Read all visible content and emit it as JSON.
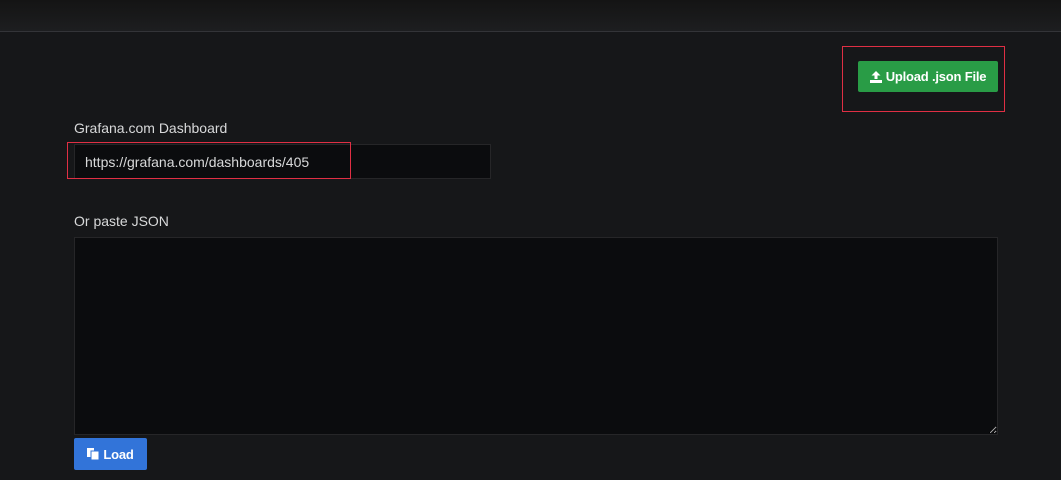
{
  "buttons": {
    "upload_label": "Upload .json File",
    "load_label": "Load"
  },
  "grafana_com": {
    "label": "Grafana.com Dashboard",
    "url_value": "https://grafana.com/dashboards/405"
  },
  "paste_json": {
    "label": "Or paste JSON",
    "value": ""
  },
  "icons": {
    "upload": "upload-icon",
    "load": "copy-icon"
  },
  "colors": {
    "background": "#161719",
    "upload_button": "#299c46",
    "load_button": "#3274d9",
    "highlight": "#e02f44"
  }
}
